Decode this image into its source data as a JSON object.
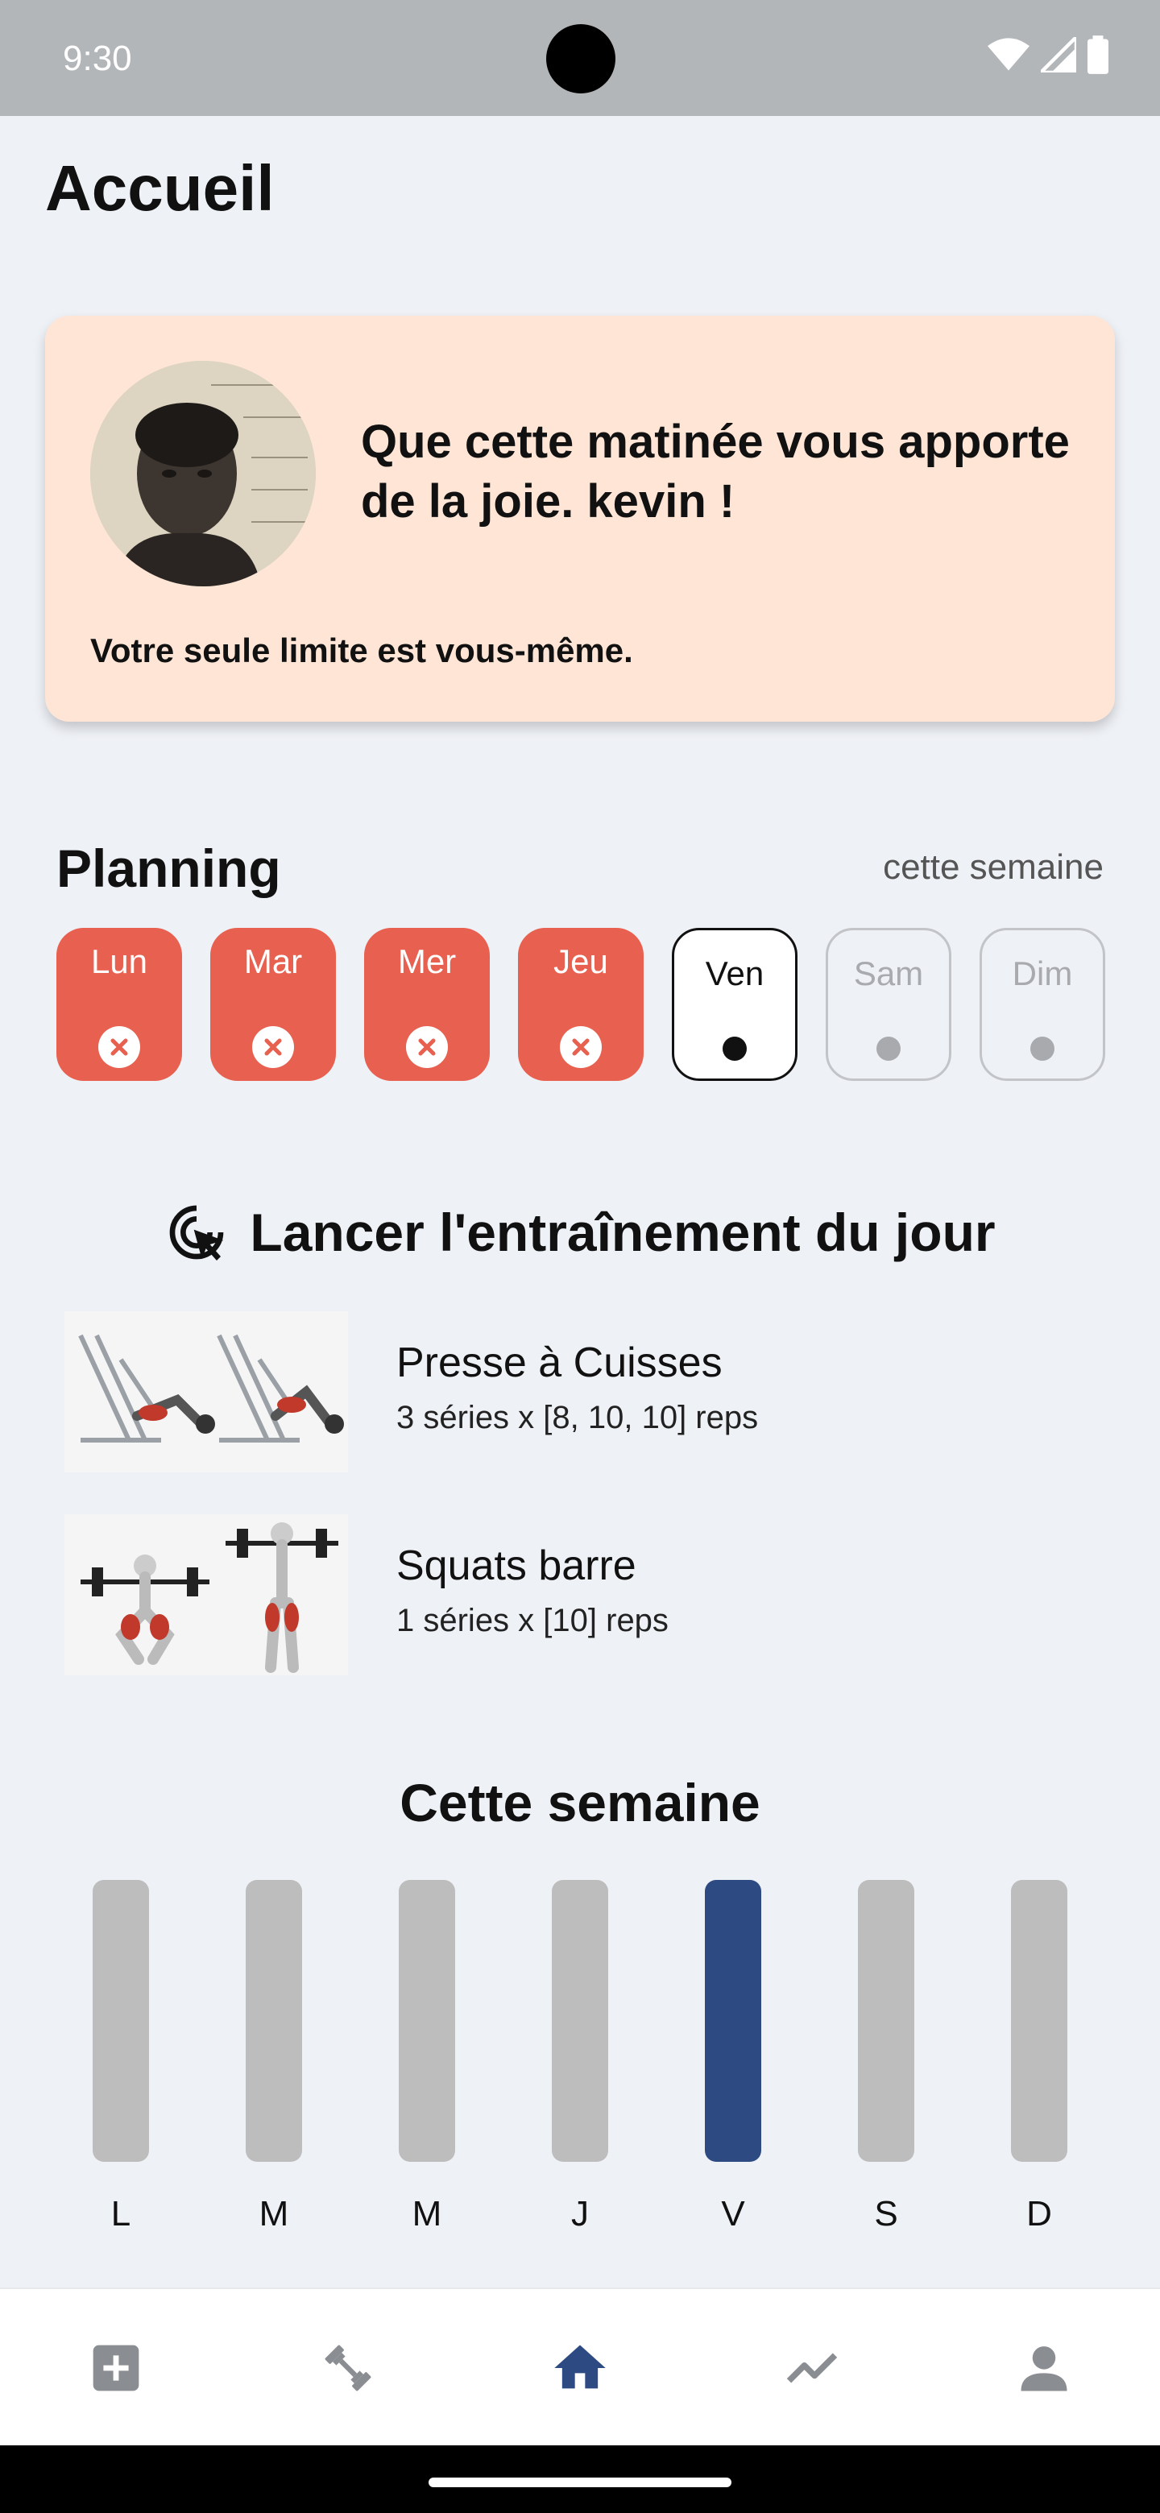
{
  "status_bar": {
    "time": "9:30"
  },
  "header": {
    "title": "Accueil"
  },
  "greeting": {
    "message": "Que cette matinée vous apporte de la joie. kevin !",
    "quote": "Votre seule limite est vous-même."
  },
  "planning": {
    "title": "Planning",
    "range": "cette semaine",
    "days": [
      {
        "label": "Lun",
        "status": "missed"
      },
      {
        "label": "Mar",
        "status": "missed"
      },
      {
        "label": "Mer",
        "status": "missed"
      },
      {
        "label": "Jeu",
        "status": "missed"
      },
      {
        "label": "Ven",
        "status": "current"
      },
      {
        "label": "Sam",
        "status": "upcoming"
      },
      {
        "label": "Dim",
        "status": "upcoming"
      }
    ]
  },
  "workout": {
    "launch_label": "Lancer l'entraînement du jour",
    "exercises": [
      {
        "name": "Presse à Cuisses",
        "detail": "3 séries x [8, 10, 10] reps"
      },
      {
        "name": "Squats barre",
        "detail": "1 séries x [10] reps"
      }
    ]
  },
  "week": {
    "title": "Cette semaine",
    "days": [
      {
        "label": "L",
        "active": false
      },
      {
        "label": "M",
        "active": false
      },
      {
        "label": "M",
        "active": false
      },
      {
        "label": "J",
        "active": false
      },
      {
        "label": "V",
        "active": true
      },
      {
        "label": "S",
        "active": false
      },
      {
        "label": "D",
        "active": false
      }
    ]
  },
  "bottom_nav": {
    "items": [
      {
        "icon": "add-box-icon",
        "active": false
      },
      {
        "icon": "dumbbell-icon",
        "active": false
      },
      {
        "icon": "home-icon",
        "active": true
      },
      {
        "icon": "trending-icon",
        "active": false
      },
      {
        "icon": "person-icon",
        "active": false
      }
    ]
  },
  "colors": {
    "missed": "#e8604f",
    "active_bar": "#2d4b82",
    "inactive_bar": "#bdbdbd",
    "card_bg": "#ffe5d6",
    "nav_active": "#2d4b82",
    "nav_inactive": "#8a8d91"
  }
}
